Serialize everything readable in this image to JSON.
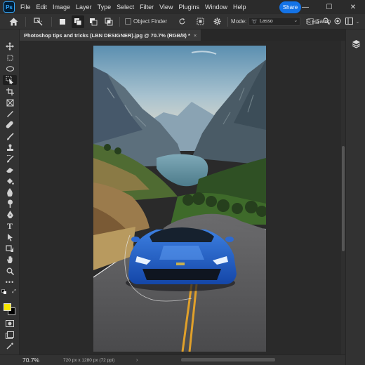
{
  "app": {
    "logo": "Ps"
  },
  "menu": [
    "File",
    "Edit",
    "Image",
    "Layer",
    "Type",
    "Select",
    "Filter",
    "View",
    "Plugins",
    "Window",
    "Help"
  ],
  "window_controls": {
    "minimize": "—",
    "maximize": "☐",
    "close": "✕"
  },
  "options": {
    "object_finder_label": "Object Finder",
    "mode_label": "Mode:",
    "mode_value": "Lasso",
    "sample_label": "Samp",
    "share_label": "Share",
    "hand_label": "Ha"
  },
  "document": {
    "tab_title": "Photoshop tips and tricks (LBN DESIGNER).jpg @ 70.7% (RGB/8) *",
    "close_label": "×"
  },
  "status": {
    "zoom": "70.7%",
    "doc_info": "720 px x 1280 px (72 ppi)",
    "arrow": "›"
  },
  "colors": {
    "foreground": "#f6e600",
    "background": "#000000",
    "share_button": "#1473e6"
  },
  "icons": {
    "toolbar": [
      "move-icon",
      "artboard-icon",
      "marquee-icon",
      "lasso-icon",
      "object-select-icon",
      "crop-icon",
      "frame-icon",
      "eyedropper-icon",
      "healing-icon",
      "brush-icon",
      "clone-stamp-icon",
      "history-brush-icon",
      "eraser-icon",
      "paint-bucket-icon",
      "blur-icon",
      "dodge-icon",
      "pen-icon",
      "type-icon",
      "path-select-icon",
      "shape-icon",
      "hand-icon",
      "zoom-icon",
      "more-tools-icon"
    ]
  }
}
